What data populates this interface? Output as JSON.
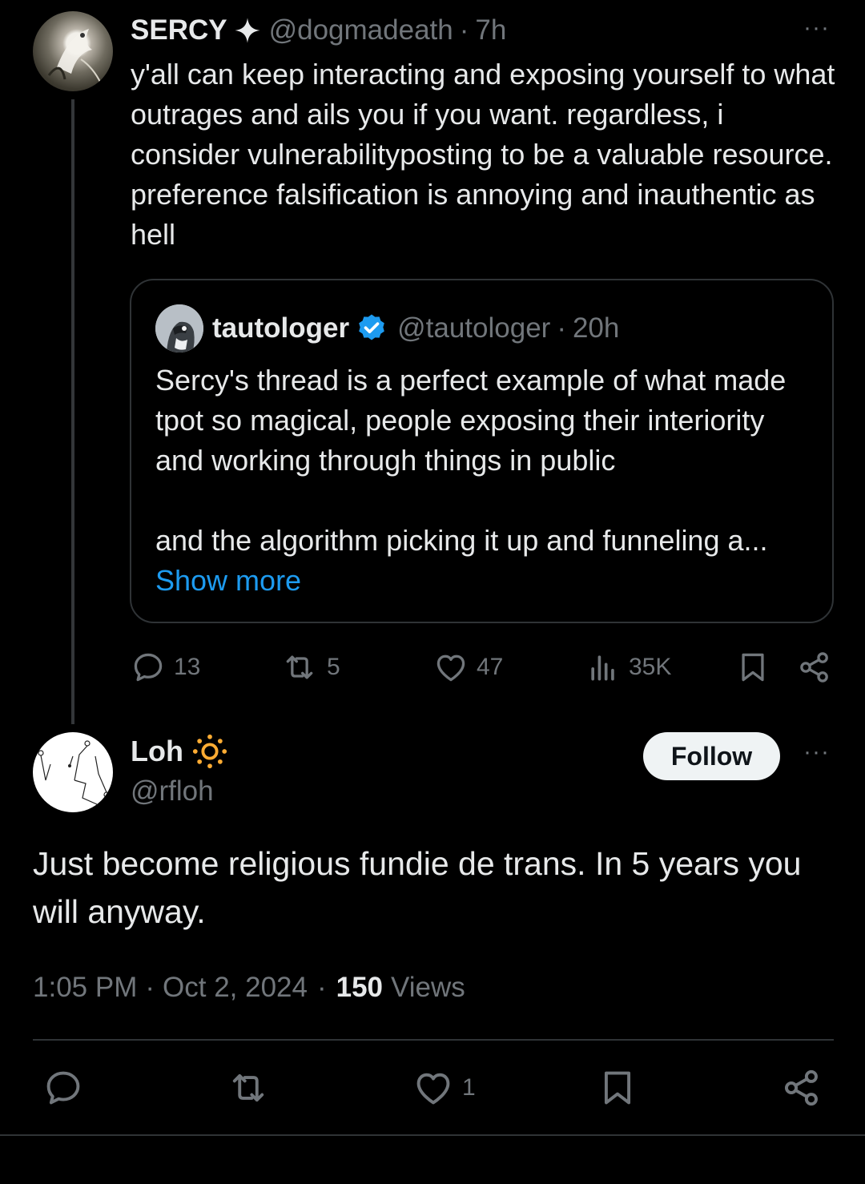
{
  "parent": {
    "display_name": "SERCY",
    "name_badge_icon": "four-point-star-icon",
    "handle": "@dogmadeath",
    "separator": "·",
    "time": "7h",
    "more": "···",
    "text": "y'all can keep interacting and exposing yourself to what outrages and ails you if you want. regardless, i consider vulnerabilityposting to be a valuable resource. preference falsification is annoying and inauthentic as hell",
    "quote": {
      "display_name": "tautologer",
      "verified_icon": "verified-badge-icon",
      "handle": "@tautologer",
      "separator": "·",
      "time": "20h",
      "text_p1": "Sercy's thread is a perfect example of what made tpot so magical, people exposing their interiority and working through things in public",
      "text_p2": "and the algorithm picking it up and funneling a...",
      "show_more": "Show more"
    },
    "actions": {
      "replies": "13",
      "reposts": "5",
      "likes": "47",
      "views": "35K"
    }
  },
  "reply": {
    "display_name": "Loh",
    "name_emoji": "sun-icon",
    "handle": "@rfloh",
    "follow_label": "Follow",
    "more": "···",
    "text": "Just become religious fundie de trans. In 5 years you will anyway.",
    "time": "1:05 PM",
    "separator": "·",
    "date": "Oct 2, 2024",
    "view_count": "150",
    "views_label": "Views",
    "actions": {
      "likes": "1"
    }
  },
  "colors": {
    "background": "#000000",
    "text": "#e7e9ea",
    "muted": "#71767b",
    "link": "#1d9bf0",
    "verified": "#1d9bf0",
    "sun": "#ffac33",
    "border": "#2f3336"
  }
}
